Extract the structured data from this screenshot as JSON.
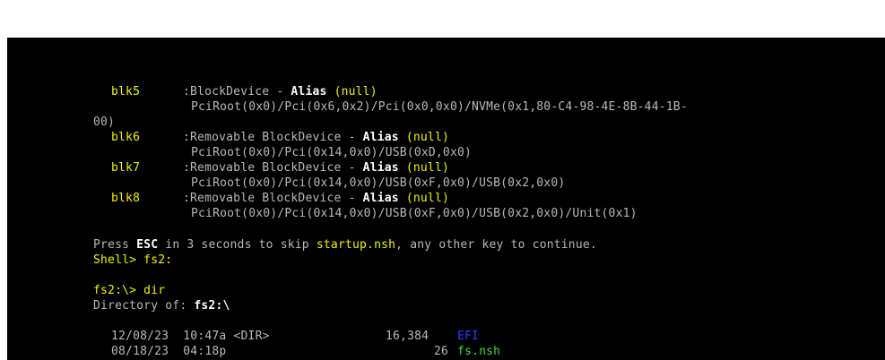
{
  "devices": [
    {
      "name": "blk5",
      "desc": ":BlockDevice - ",
      "alias_label": "Alias",
      "alias_value": "(null)",
      "path": "PciRoot(0x0)/Pci(0x6,0x2)/Pci(0x0,0x0)/NVMe(0x1,80-C4-98-4E-8B-44-1B-",
      "path_cont": "00)"
    },
    {
      "name": "blk6",
      "desc": ":Removable BlockDevice - ",
      "alias_label": "Alias",
      "alias_value": "(null)",
      "path": "PciRoot(0x0)/Pci(0x14,0x0)/USB(0xD,0x0)"
    },
    {
      "name": "blk7",
      "desc": ":Removable BlockDevice - ",
      "alias_label": "Alias",
      "alias_value": "(null)",
      "path": "PciRoot(0x0)/Pci(0x14,0x0)/USB(0xF,0x0)/USB(0x2,0x0)"
    },
    {
      "name": "blk8",
      "desc": ":Removable BlockDevice - ",
      "alias_label": "Alias",
      "alias_value": "(null)",
      "path": "PciRoot(0x0)/Pci(0x14,0x0)/USB(0xF,0x0)/USB(0x2,0x0)/Unit(0x1)"
    }
  ],
  "startup": {
    "prefix": "Press ",
    "key": "ESC",
    "middle": " in 3 seconds to skip ",
    "script": "startup.nsh",
    "suffix": ", any other key to continue."
  },
  "prompt1": "Shell> fs2:",
  "prompt2": "fs2:\\> dir",
  "dir_header": {
    "label": "Directory of: ",
    "path": "fs2:\\"
  },
  "entries": [
    {
      "date": "12/08/23",
      "time": "10:47a",
      "type": "<DIR>",
      "size": "16,384",
      "name": "EFI"
    },
    {
      "date": "08/18/23",
      "time": "04:18p",
      "type": "",
      "size": "26",
      "name": "fs.nsh"
    }
  ],
  "colors": {
    "yellow": "#f0f000",
    "gray": "#b8b8b8",
    "white": "#ffffff",
    "dir_blue": "#2f3cff",
    "file_green": "#3cdc3c"
  }
}
